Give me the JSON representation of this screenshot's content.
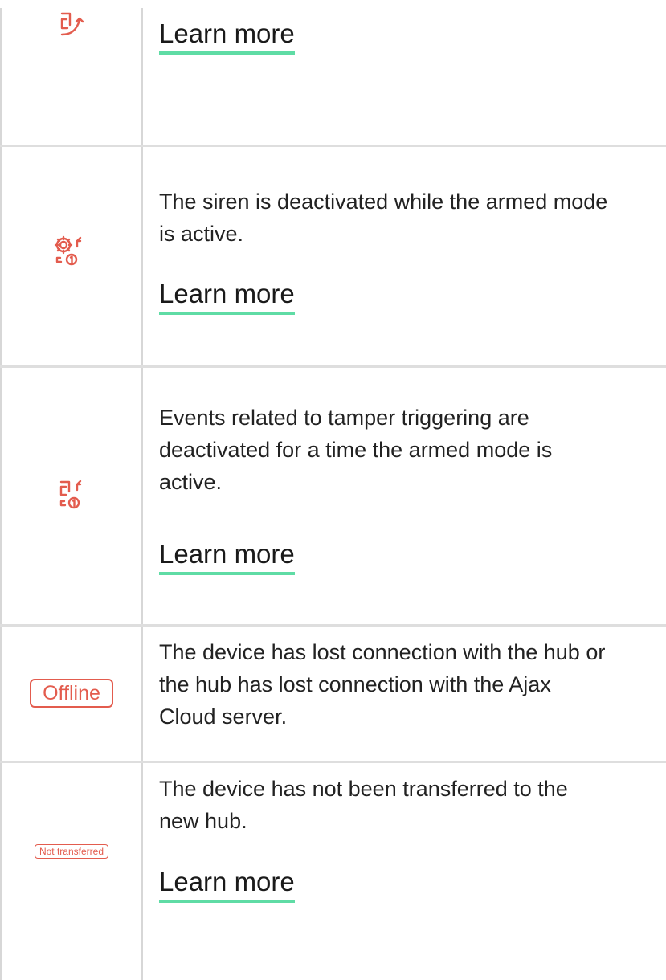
{
  "colors": {
    "icon_accent": "#e35c4e",
    "link_underline": "#5fdca5",
    "text": "#222222",
    "grid_line": "#d7d7d7"
  },
  "rows": [
    {
      "icon": "tamper-arrow-icon",
      "description_lines": [],
      "link_label": "Learn more"
    },
    {
      "icon": "gear-deactivated-icon",
      "description_lines": [
        "The siren is deactivated while the armed mode",
        "is active."
      ],
      "link_label": "Learn more"
    },
    {
      "icon": "tamper-deactivated-icon",
      "description_lines": [
        "Events related to tamper triggering are",
        "deactivated for a time the armed mode is",
        "active."
      ],
      "link_label": "Learn more"
    },
    {
      "badge": "Offline",
      "description_lines": [
        "The device has lost connection with the hub or",
        "the hub has lost connection with the Ajax",
        "Cloud server."
      ]
    },
    {
      "badge": "Not transferred",
      "description_lines": [
        "The device has not been transferred to the",
        "new hub."
      ],
      "link_label": "Learn more"
    }
  ]
}
